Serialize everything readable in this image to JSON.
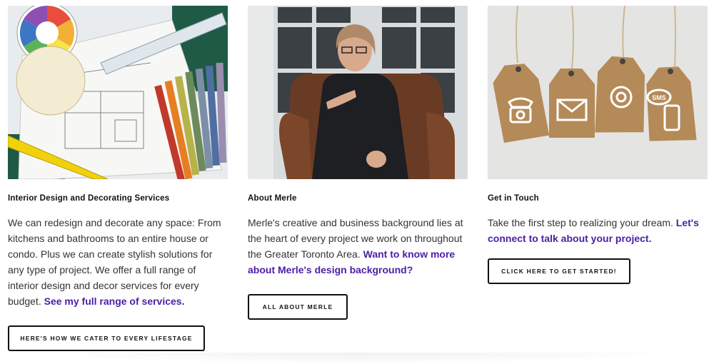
{
  "columns": [
    {
      "image_alt": "Design tools: color wheel, scale ruler, floor plan, paint swatches, tape measure",
      "title": "Interior Design and Decorating Services",
      "description": "We can redesign and decorate any space: From kitchens and bathrooms to an entire house or condo. Plus we can create stylish solutions for any type of project. We offer a full range of interior design and decor services for every budget.",
      "link": "See my full range of services.",
      "button": "HERE'S HOW WE CATER TO EVERY LIFESTAGE"
    },
    {
      "image_alt": "Merle seated in a brown leather armchair",
      "title": "About Merle",
      "description": "Merle's creative and business background lies at the heart of every project we work on throughout the Greater Toronto Area.",
      "link": "Want to know more about Merle's design background?",
      "button": "ALL ABOUT MERLE"
    },
    {
      "image_alt": "Cork tags with phone, email, at and SMS icons",
      "title": "Get in Touch",
      "description": "Take the first step to realizing your dream.",
      "link": "Let's connect to talk about your project.",
      "button": "CLICK HERE TO GET STARTED!",
      "tag_text": "SMS"
    }
  ],
  "colors": {
    "link": "#4b1ea8",
    "text": "#333333",
    "button_border": "#111111"
  }
}
